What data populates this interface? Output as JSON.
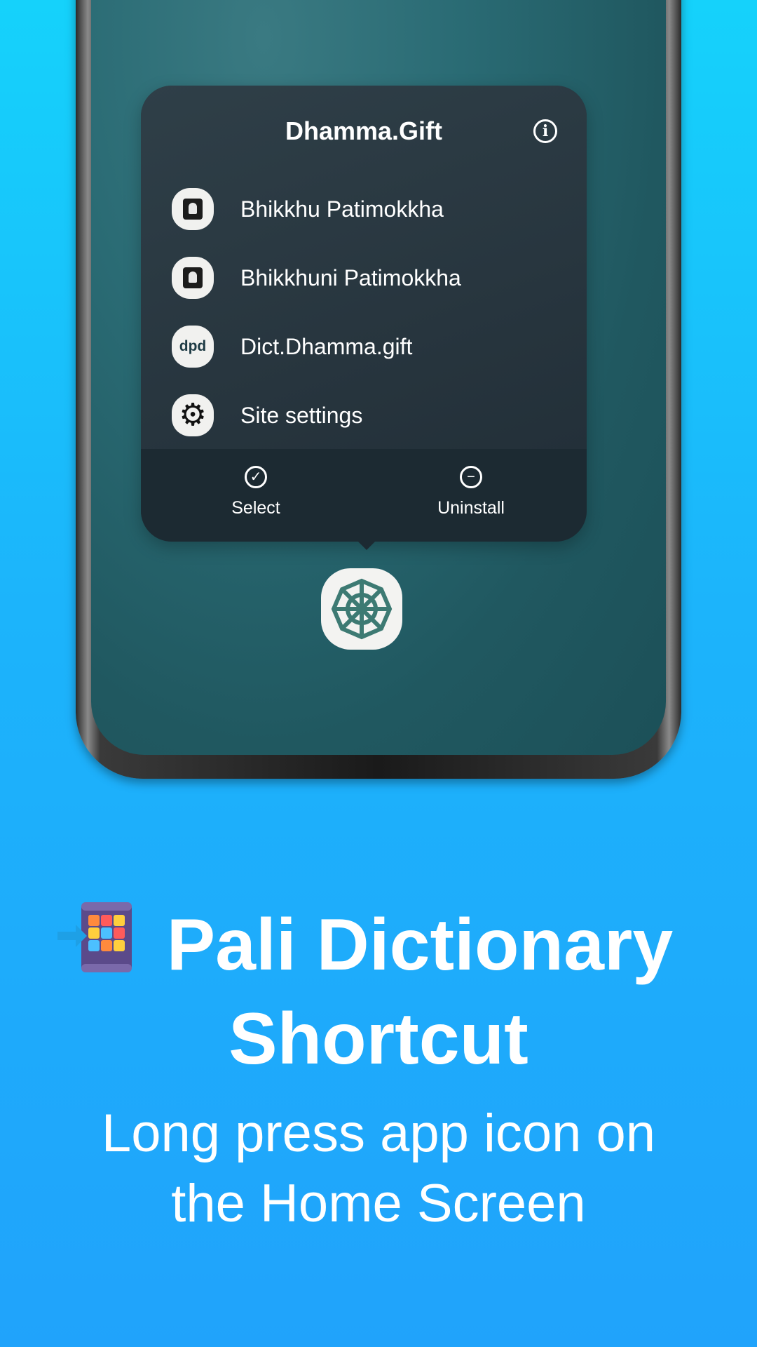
{
  "popup": {
    "title": "Dhamma.Gift",
    "info_icon": "info-icon",
    "items": [
      {
        "label": "Bhikkhu Patimokkha",
        "icon": "monk-book-icon"
      },
      {
        "label": "Bhikkhuni Patimokkha",
        "icon": "monk-book-icon"
      },
      {
        "label": "Dict.Dhamma.gift",
        "icon": "dpd-icon",
        "icon_text": "dpd"
      },
      {
        "label": "Site settings",
        "icon": "gear-icon"
      }
    ],
    "actions": [
      {
        "label": "Select",
        "icon": "check-circle-icon"
      },
      {
        "label": "Uninstall",
        "icon": "minus-circle-icon"
      }
    ]
  },
  "app_icon": "dharma-wheel-icon",
  "headline": {
    "line1": "Pali Dictionary",
    "line2": "Shortcut",
    "emoji": "app-grid-shortcut-icon"
  },
  "subtitle": {
    "line1": "Long press app icon on",
    "line2": "the Home Screen"
  },
  "colors": {
    "background_top": "#15d2fb",
    "background_bottom": "#20a3fb",
    "popup_bg": "#24343d",
    "wallpaper": "#205860",
    "wheel": "#3d7a73"
  }
}
